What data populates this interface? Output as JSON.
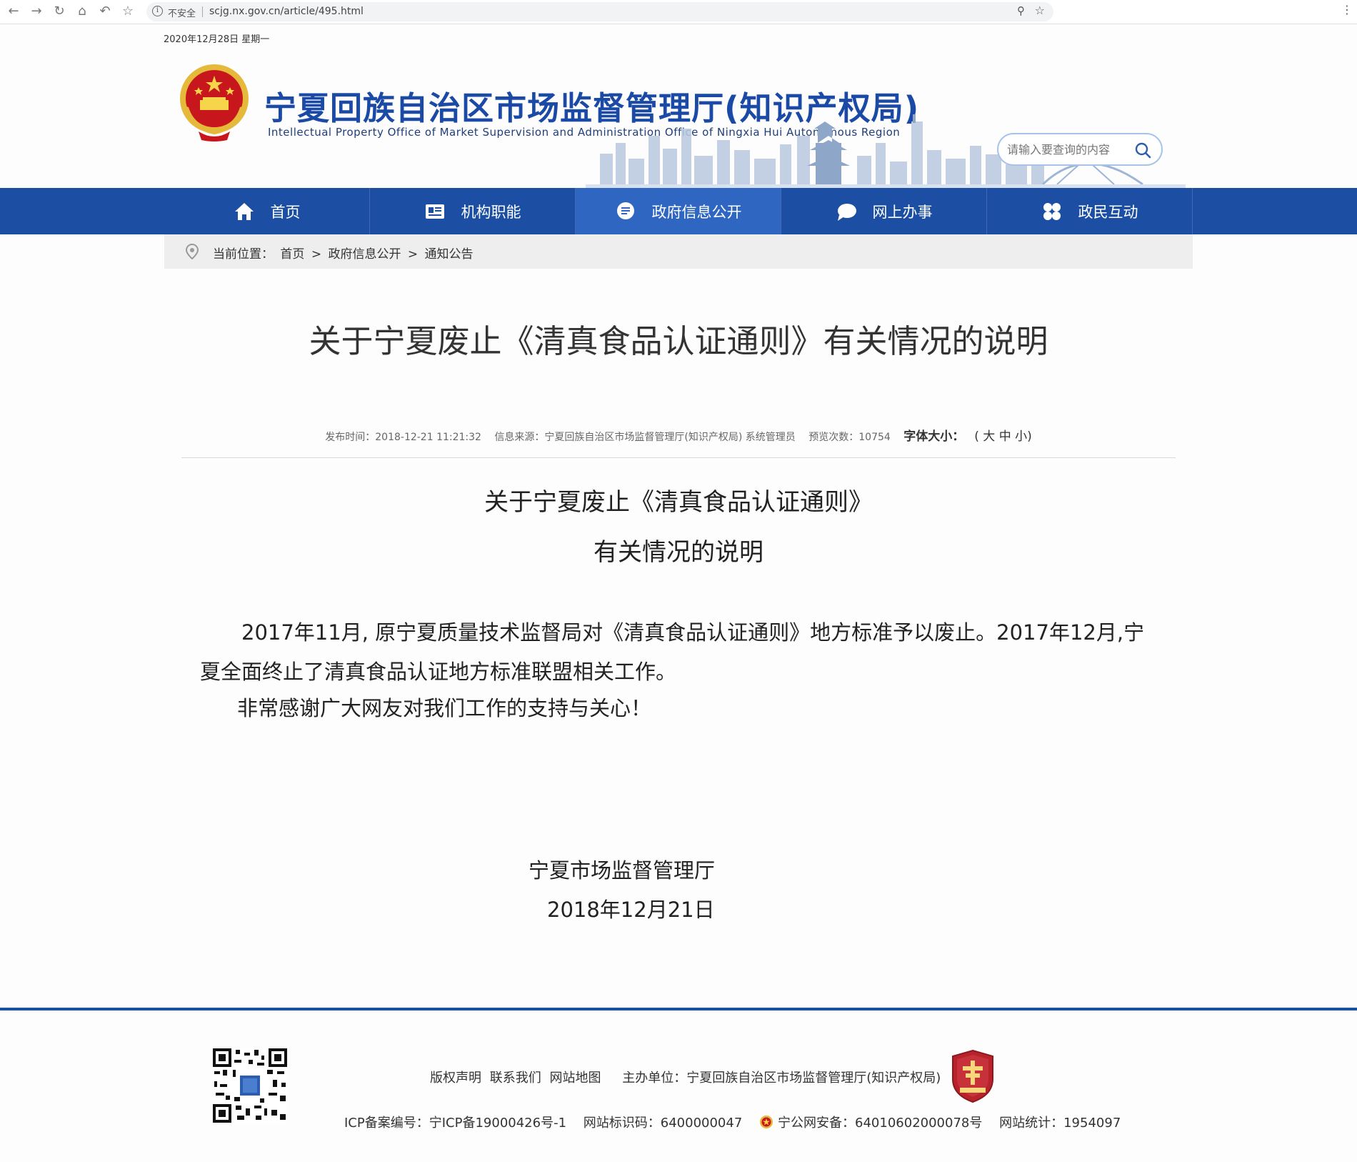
{
  "browser": {
    "insecure_label": "不安全",
    "url": "scjg.nx.gov.cn/article/495.html"
  },
  "header": {
    "date": "2020年12月28日 星期一",
    "site_title": "宁夏回族自治区市场监督管理厅(知识产权局)",
    "site_subtitle": "Intellectual Property Office of Market Supervision and Administration Office of Ningxia Hui Autonomous Region",
    "search_placeholder": "请输入要查询的内容"
  },
  "nav": {
    "items": [
      {
        "label": "首页",
        "icon": "home-icon"
      },
      {
        "label": "机构职能",
        "icon": "id-card-icon"
      },
      {
        "label": "政府信息公开",
        "icon": "document-bubble-icon",
        "active": true
      },
      {
        "label": "网上办事",
        "icon": "chat-bubble-icon"
      },
      {
        "label": "政民互动",
        "icon": "grid-icon"
      }
    ]
  },
  "breadcrumb": {
    "prefix": "当前位置：",
    "items": [
      "首页",
      "政府信息公开",
      "通知公告"
    ],
    "separator": ">"
  },
  "article": {
    "title": "关于宁夏废止《清真食品认证通则》有关情况的说明",
    "publish_time": "发布时间：2018-12-21 11:21:32",
    "source": "信息来源：宁夏回族自治区市场监督管理厅(知识产权局) 系统管理员",
    "views": "预览次数：10754",
    "font_size_label": "字体大小：",
    "font_size_options": "( 大 中 小)",
    "subtitle_line1": "关于宁夏废止《清真食品认证通则》",
    "subtitle_line2": "有关情况的说明",
    "paragraph1": "2017年11月, 原宁夏质量技术监督局对《清真食品认证通则》地方标准予以废止。2017年12月,宁夏全面终止了清真食品认证地方标准联盟相关工作。",
    "paragraph2": "非常感谢广大网友对我们工作的支持与关心！",
    "signature_org": "宁夏市场监督管理厅",
    "signature_date": "2018年12月21日"
  },
  "footer": {
    "links": [
      "版权声明",
      "联系我们",
      "网站地图"
    ],
    "host": "主办单位：宁夏回族自治区市场监督管理厅(知识产权局)",
    "icp": "ICP备案编号：宁ICP备19000426号-1",
    "site_code": "网站标识码：6400000047",
    "police": "宁公网安备：64010602000078号",
    "stats": "网站统计：1954097"
  },
  "colors": {
    "nav_bg": "#1c4fa3",
    "nav_active": "#2e66c2",
    "title_blue": "#1a4aa6",
    "badge_red": "#b8232b"
  }
}
